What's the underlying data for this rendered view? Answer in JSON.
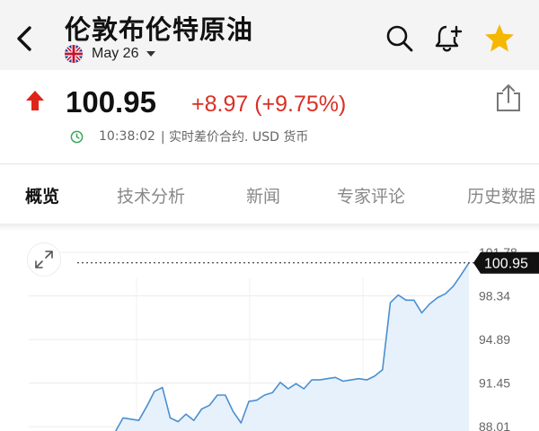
{
  "header": {
    "title": "伦敦布伦特原油",
    "date": "May 26",
    "icons": [
      "back-arrow-icon",
      "uk-flag-icon",
      "dropdown-caret-icon",
      "search-icon",
      "bell-plus-icon",
      "star-icon"
    ]
  },
  "quote": {
    "price": "100.95",
    "change": "+8.97 (+9.75%)",
    "time": "10:38:02",
    "description": "| 实时差价合约. USD 货币",
    "colors": {
      "up": "#d93025",
      "accent_star": "#f5b700",
      "time_icon": "#3aa757"
    }
  },
  "tabs": [
    {
      "label": "概览",
      "active": true
    },
    {
      "label": "技术分析",
      "active": false
    },
    {
      "label": "新闻",
      "active": false
    },
    {
      "label": "专家评论",
      "active": false
    },
    {
      "label": "历史数据",
      "active": false
    }
  ],
  "chart_data": {
    "type": "area",
    "ylim": [
      86.6,
      101.78
    ],
    "y_tick_labels": [
      "101.78",
      "98.34",
      "94.89",
      "91.45",
      "88.01"
    ],
    "y_tick_values": [
      101.78,
      98.34,
      94.89,
      91.45,
      88.01
    ],
    "current_value": 100.95,
    "current_label": "100.95",
    "grid": true,
    "series": [
      {
        "values": [
          87.6,
          87.3,
          86.9,
          86.5,
          86.8,
          86.8,
          87.0,
          87.4,
          87.0,
          87.5,
          87.3,
          87.6,
          88.7,
          88.6,
          88.5,
          89.6,
          90.8,
          91.1,
          88.7,
          88.4,
          89.0,
          88.5,
          89.4,
          89.7,
          90.5,
          90.5,
          89.2,
          88.3,
          90.0,
          90.1,
          90.5,
          90.7,
          91.5,
          91.0,
          91.4,
          91.0,
          91.7,
          91.7,
          91.8,
          91.9,
          91.6,
          91.7,
          91.8,
          91.7,
          92.0,
          92.5,
          97.8,
          98.4,
          98.0,
          98.0,
          97.0,
          97.7,
          98.2,
          98.5,
          99.1,
          100.0,
          100.95
        ]
      }
    ]
  }
}
